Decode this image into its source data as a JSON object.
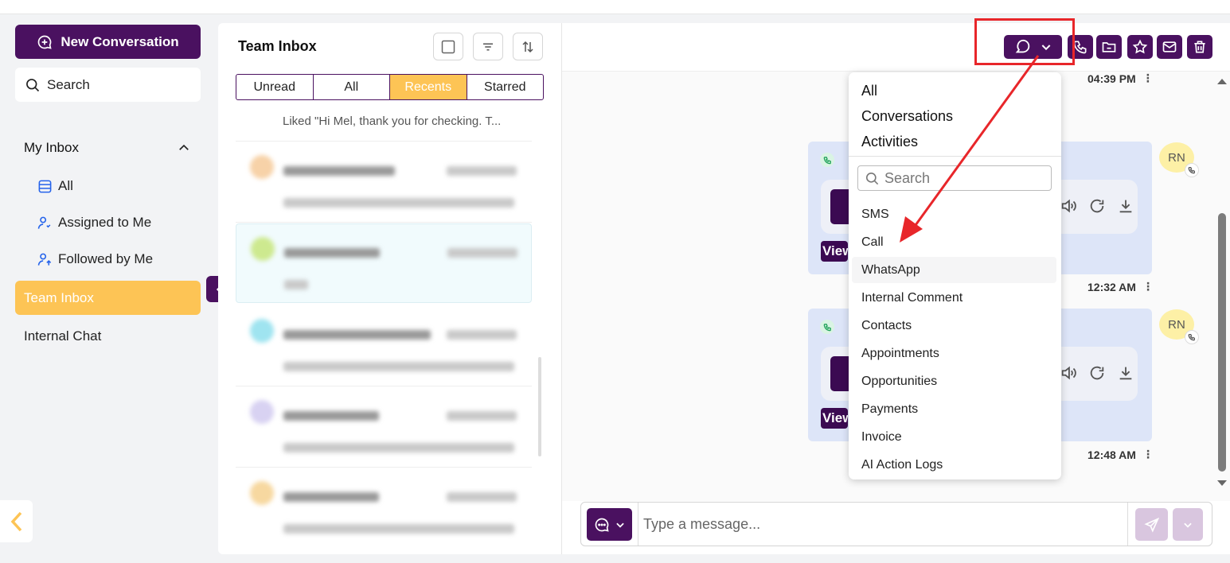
{
  "sidebar": {
    "new_conversation": "New Conversation",
    "search": "Search",
    "my_inbox": "My Inbox",
    "items": [
      {
        "label": "All"
      },
      {
        "label": "Assigned to Me"
      },
      {
        "label": "Followed by Me"
      }
    ],
    "team_inbox": "Team Inbox",
    "internal_chat": "Internal Chat"
  },
  "list": {
    "title": "Team Inbox",
    "tabs": [
      "Unread",
      "All",
      "Recents",
      "Starred"
    ],
    "active_tab": "Recents",
    "preview_text": "Liked \"Hi Mel, thank you for checking. T..."
  },
  "messages": {
    "times": [
      "04:39 PM",
      "12:32 AM",
      "12:48 AM"
    ],
    "avatar_initials": "RN",
    "view_label": "View",
    "dots": "⋮"
  },
  "composer": {
    "placeholder": "Type a message..."
  },
  "dropdown": {
    "header_items": [
      "All",
      "Conversations",
      "Activities"
    ],
    "search_placeholder": "Search",
    "items": [
      "SMS",
      "Call",
      "WhatsApp",
      "Internal Comment",
      "Contacts",
      "Appointments",
      "Opportunities",
      "Payments",
      "Invoice",
      "AI Action Logs"
    ],
    "hover_item": "WhatsApp"
  },
  "colors": {
    "brand": "#4a1160",
    "accent": "#fdc455",
    "annotation": "#e8262a"
  }
}
